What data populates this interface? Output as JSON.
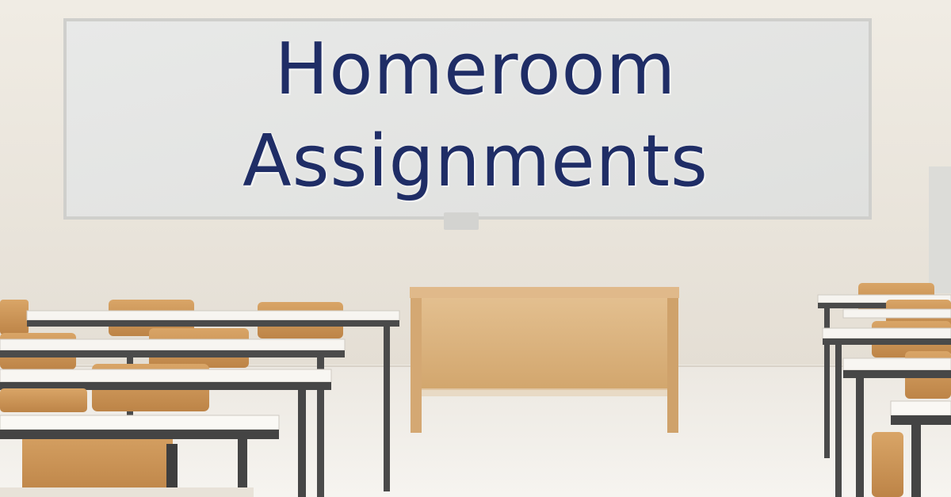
{
  "headline": {
    "line1": "Homeroom",
    "line2": "Assignments",
    "color": "#1f2d66"
  },
  "scene": {
    "subject": "empty classroom with whiteboard, desks and chairs",
    "wall_color": "#ebe6dd",
    "floor_color": "#f2efe9",
    "wood_color": "#c9955b"
  }
}
